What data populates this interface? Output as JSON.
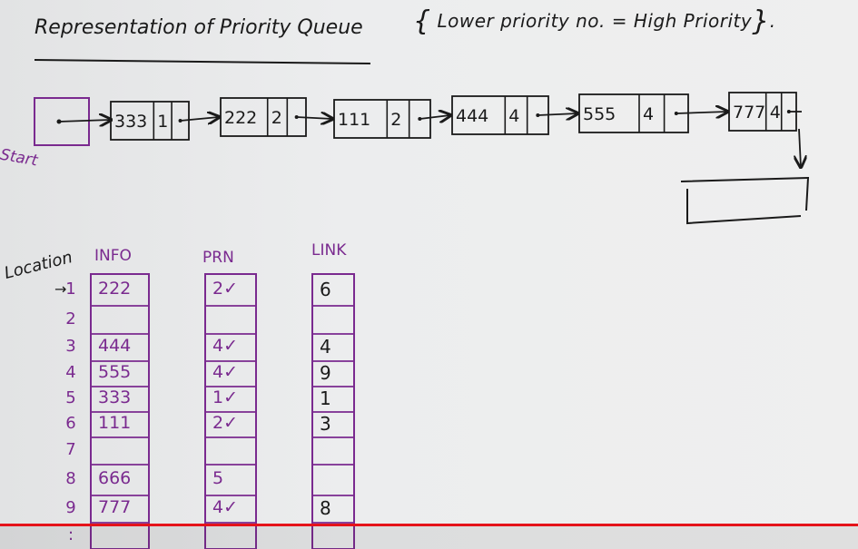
{
  "title": "Representation of Priority Queue",
  "note": "Lower priority no. = High Priority",
  "start_label": "Start",
  "location_label": "Location",
  "location_arrow": "→",
  "linked_list": [
    {
      "info": "333",
      "prn": "1"
    },
    {
      "info": "222",
      "prn": "2"
    },
    {
      "info": "111",
      "prn": "2"
    },
    {
      "info": "444",
      "prn": "4"
    },
    {
      "info": "555",
      "prn": "4"
    },
    {
      "info": "777",
      "prn": "4"
    }
  ],
  "columns": {
    "info": "INFO",
    "prn": "PRN",
    "link": "LINK"
  },
  "rows": [
    {
      "loc": "1",
      "info": "222",
      "prn": "2✓",
      "link": "6"
    },
    {
      "loc": "2",
      "info": "",
      "prn": "",
      "link": ""
    },
    {
      "loc": "3",
      "info": "444",
      "prn": "4✓",
      "link": "4"
    },
    {
      "loc": "4",
      "info": "555",
      "prn": "4✓",
      "link": "9"
    },
    {
      "loc": "5",
      "info": "333",
      "prn": "1✓",
      "link": "1"
    },
    {
      "loc": "6",
      "info": "111",
      "prn": "2✓",
      "link": "3"
    },
    {
      "loc": "7",
      "info": "",
      "prn": "",
      "link": ""
    },
    {
      "loc": "8",
      "info": "666",
      "prn": "5",
      "link": ""
    },
    {
      "loc": "9",
      "info": "777",
      "prn": "4✓",
      "link": "8"
    },
    {
      "loc": ":",
      "info": "",
      "prn": "",
      "link": ""
    }
  ],
  "colors": {
    "ink": "#1a1a1a",
    "purple": "#7a2a8f",
    "board": "#ececed",
    "video_bar": "#e5131a"
  }
}
